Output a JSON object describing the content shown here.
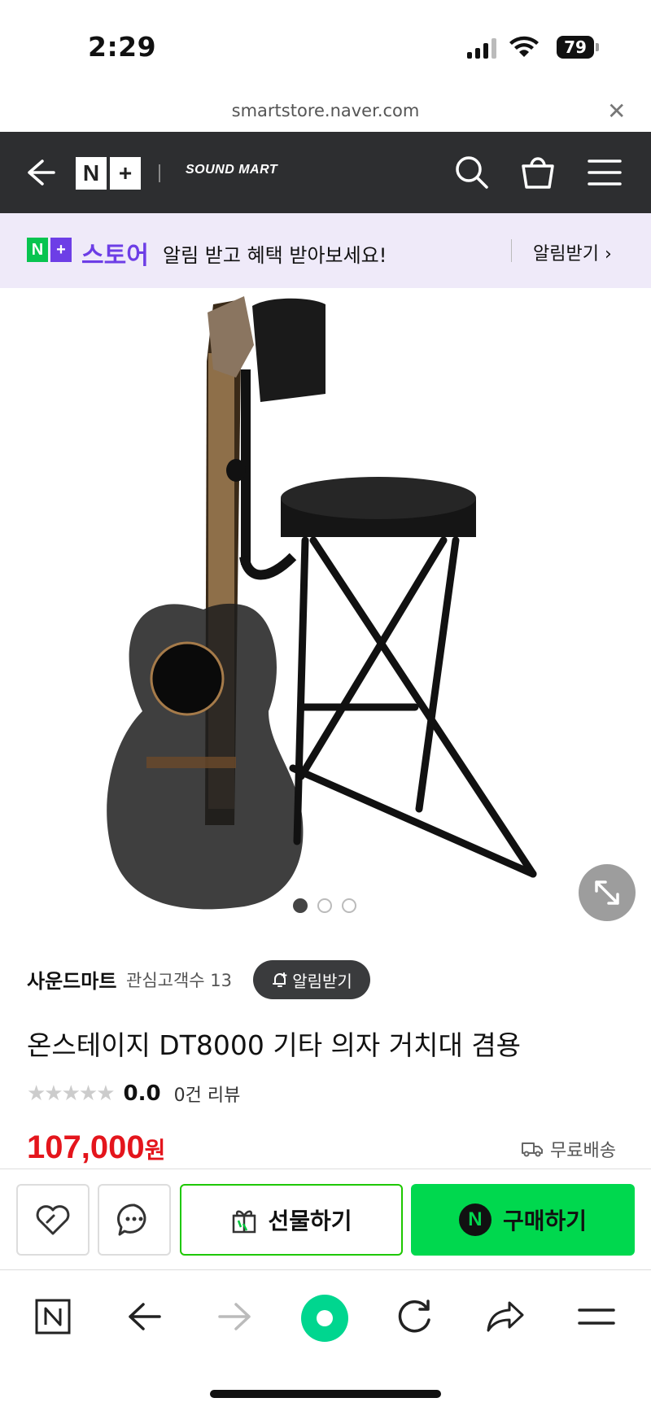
{
  "status": {
    "time": "2:29",
    "battery": "79"
  },
  "browser": {
    "url": "smartstore.naver.com"
  },
  "header": {
    "logo_n": "N",
    "logo_plus": "+",
    "brand": "SOUND MART"
  },
  "promo": {
    "logo_n": "N",
    "logo_plus": "+",
    "store": "스토어",
    "message": "알림 받고 혜택 받아보세요!",
    "cta": "알림받기 ›"
  },
  "seller": {
    "name": "사운드마트",
    "fans": "관심고객수 13",
    "alarm_label": "알림받기"
  },
  "product": {
    "title": "온스테이지 DT8000 기타 의자 거치대 겸용",
    "stars": "★★★★★",
    "rating": "0.0",
    "reviews": "0건 리뷰",
    "price": "107,000",
    "currency": "원",
    "shipping": "무료배송"
  },
  "actions": {
    "gift": "선물하기",
    "buy": "구매하기",
    "buy_badge": "N"
  },
  "colors": {
    "header": "#2d2e30",
    "promo_bg": "#efeaf9",
    "store_purple": "#6d3ee6",
    "npay_green": "#00d84e",
    "price_red": "#e4151c"
  }
}
